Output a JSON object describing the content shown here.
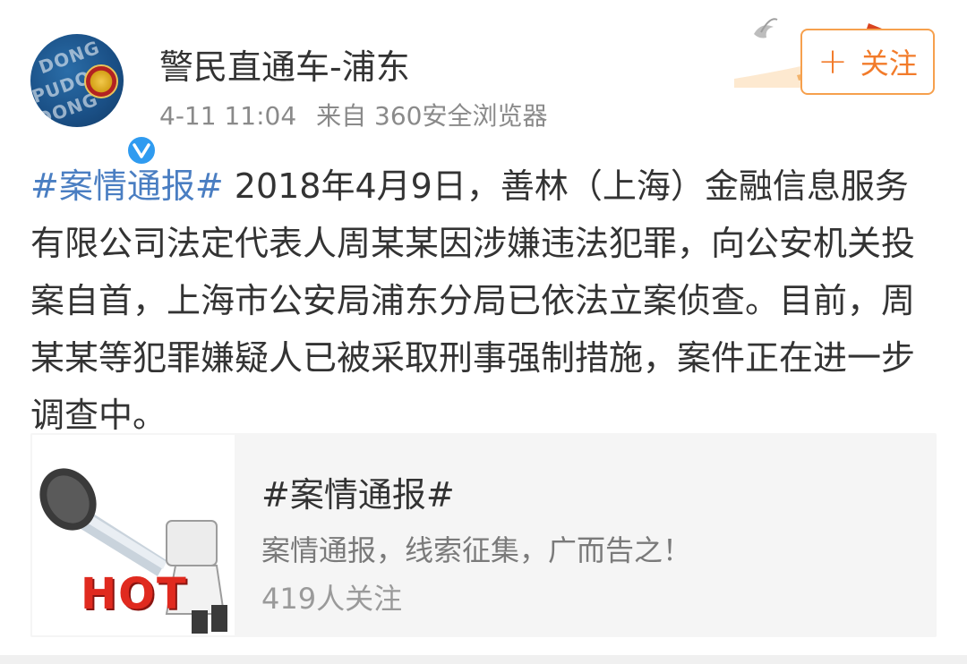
{
  "post": {
    "author": {
      "name": "警民直通车-浦东",
      "avatar_text": [
        "DONG",
        "PUDON",
        "DONG"
      ]
    },
    "time": "4-11 11:04",
    "source": "来自 360安全浏览器",
    "follow_button": {
      "plus": "+",
      "label": "关注"
    },
    "body": {
      "hashtag": "#案情通报#",
      "text": " 2018年4月9日，善林（上海）金融信息服务有限公司法定代表人周某某因涉嫌违法犯罪，向公安机关投案自首，上海市公安局浦东分局已依法立案侦查。目前，周某某等犯罪嫌疑人已被采取刑事强制措施，案件正在进一步调查中。"
    },
    "topic_card": {
      "title": "#案情通报#",
      "description": "案情通报，线索征集，广而告之！",
      "followers": "419人关注",
      "thumb_label": "HOT"
    }
  },
  "colors": {
    "link": "#4a7ec2",
    "follow_accent": "#f27b2a",
    "verified": "#2f9bf0"
  },
  "icons": {
    "verified": "verified-v-icon",
    "avatar_emblem": "police-emblem-icon",
    "thumb": "microphone-mascot-icon",
    "decor": "great-wall-dove-icon"
  }
}
